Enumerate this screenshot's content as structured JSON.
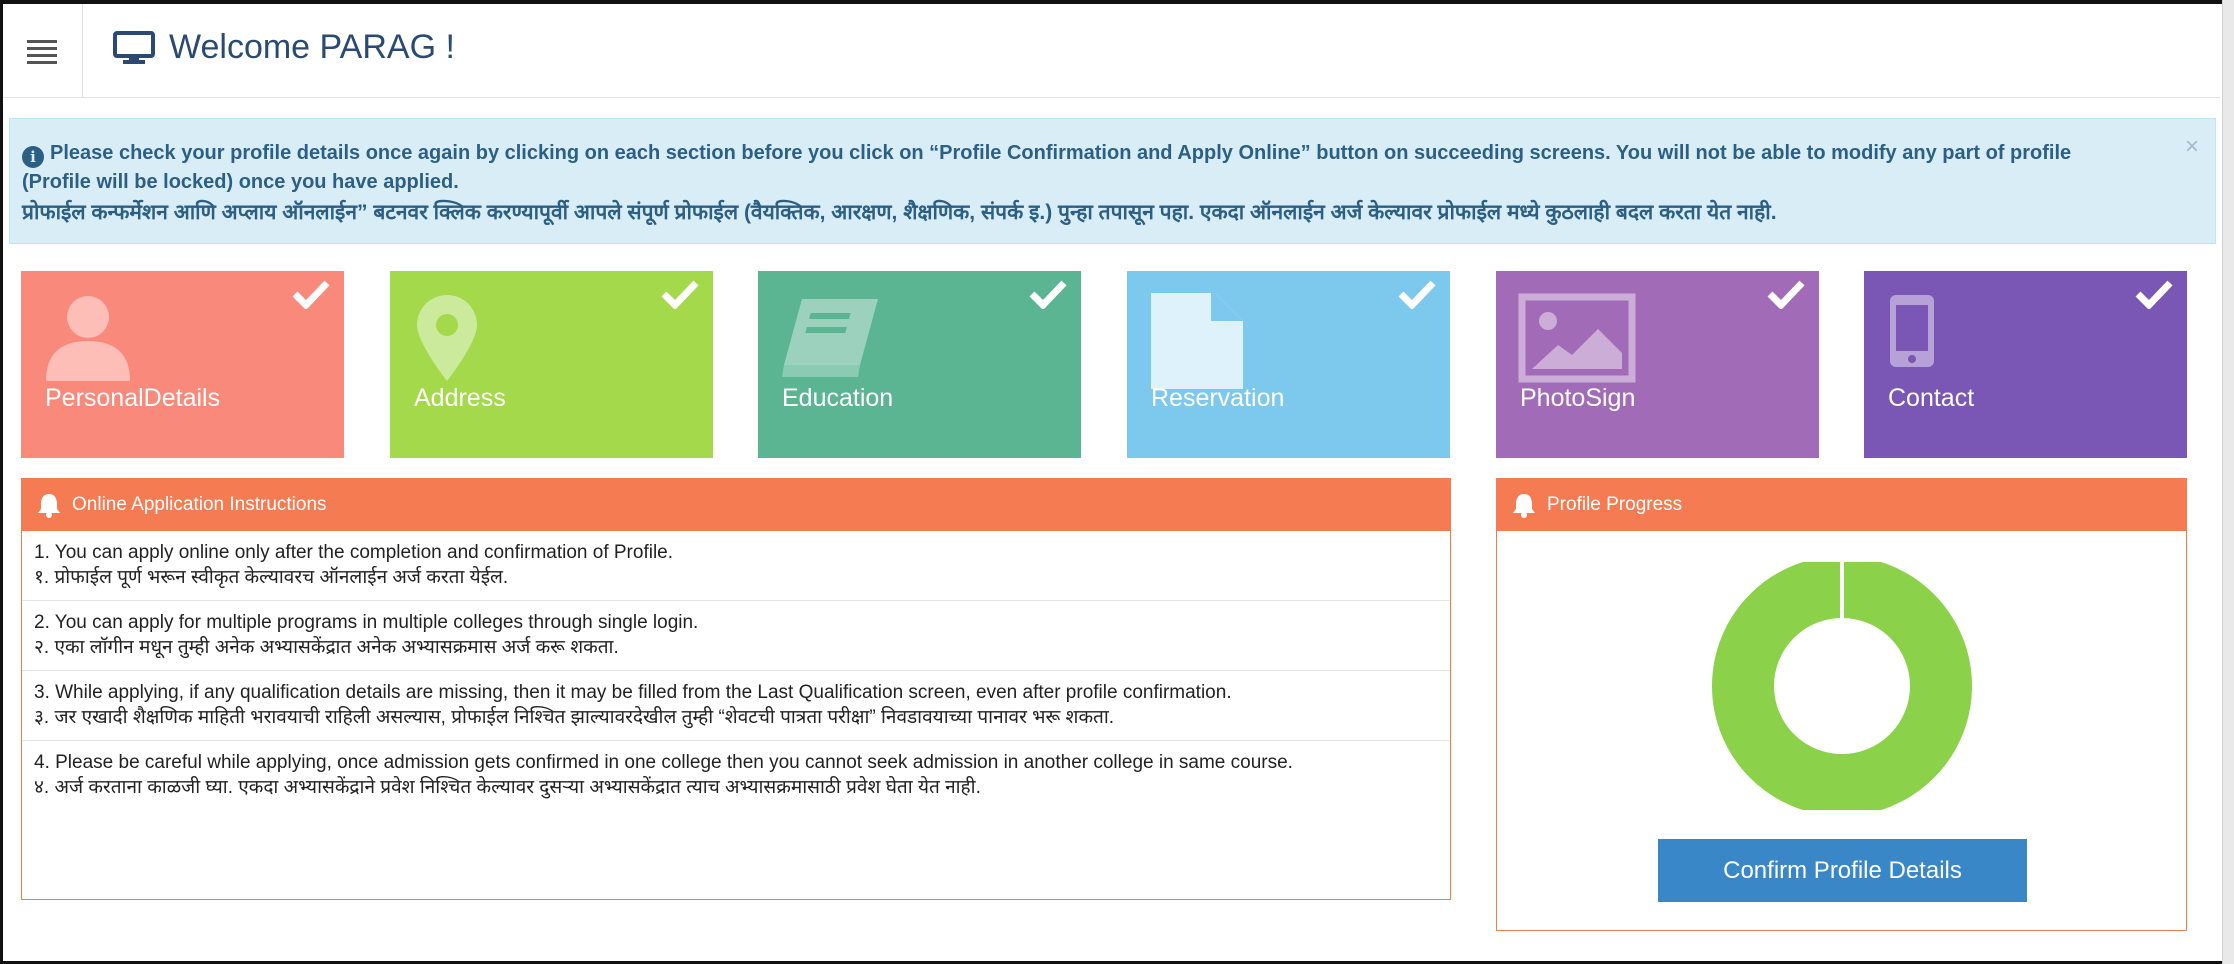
{
  "header": {
    "welcome": "Welcome PARAG !"
  },
  "alert": {
    "english": "Please check your profile details once again by clicking on each section before you click on “Profile Confirmation and Apply Online” button on succeeding screens. You will not be able to modify any part of profile (Profile will be locked) once you have applied.",
    "marathi": "प्रोफाईल कन्फर्मेशन आणि अप्लाय ऑनलाईन” बटनवर क्लिक करण्यापूर्वी आपले संपूर्ण प्रोफाईल (वैयक्तिक, आरक्षण, शैक्षणिक, संपर्क इ.) पुन्हा तपासून पहा. एकदा ऑनलाईन अर्ज केल्यावर प्रोफाईल मध्ये कुठलाही बदल करता येत नाही.",
    "close": "×"
  },
  "tiles": [
    {
      "label": "PersonalDetails",
      "color": "#f9897a",
      "icon": "person-icon"
    },
    {
      "label": "Address",
      "color": "#a3d94b",
      "icon": "map-pin-icon"
    },
    {
      "label": "Education",
      "color": "#5bb592",
      "icon": "book-icon"
    },
    {
      "label": "Reservation",
      "color": "#7dc9ee",
      "icon": "document-icon"
    },
    {
      "label": "PhotoSign",
      "color": "#a26bb8",
      "icon": "image-icon"
    },
    {
      "label": "Contact",
      "color": "#7a57b4",
      "icon": "mobile-phone-icon"
    }
  ],
  "instructions": {
    "title": "Online Application Instructions",
    "items": [
      {
        "en": "1. You can apply online only after the completion and confirmation of Profile.",
        "mr": "१. प्रोफाईल पूर्ण भरून स्वीकृत केल्यावरच ऑनलाईन अर्ज करता येईल."
      },
      {
        "en": "2. You can apply for multiple programs in multiple colleges through single login.",
        "mr": "२. एका लॉगीन मधून तुम्ही अनेक अभ्यासकेंद्रात अनेक अभ्यासक्रमास अर्ज करू शकता."
      },
      {
        "en": "3. While applying, if any qualification details are missing, then it may be filled from the Last Qualification screen, even after profile confirmation.",
        "mr": "३. जर एखादी शैक्षणिक माहिती भरावयाची राहिली असल्यास, प्रोफाईल निश्चित झाल्यावरदेखील तुम्ही “शेवटची पात्रता परीक्षा” निवडावयाच्या पानावर भरू शकता."
      },
      {
        "en": "4. Please be careful while applying, once admission gets confirmed in one college then you cannot seek admission in another college in same course.",
        "mr": "४. अर्ज करताना काळजी घ्या. एकदा अभ्यासकेंद्राने प्रवेश निश्चित केल्यावर दुसऱ्या अभ्यासकेंद्रात त्याच अभ्यासक्रमासाठी प्रवेश घेता येत नाही."
      }
    ]
  },
  "progress": {
    "title": "Profile Progress",
    "percent": 100,
    "fill_color": "#8bd14a",
    "confirm_label": "Confirm Profile Details"
  },
  "colors": {
    "panel_header": "#f47b52",
    "alert_bg": "#d9edf7",
    "button": "#3a87c8"
  }
}
